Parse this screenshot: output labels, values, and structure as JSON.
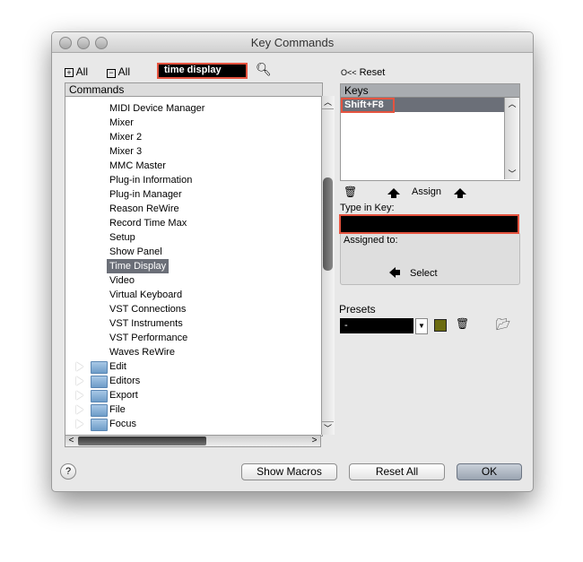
{
  "window": {
    "title": "Key Commands"
  },
  "toolbar": {
    "expand_all": "All",
    "collapse_all": "All",
    "search_value": "time display",
    "reset": "Reset",
    "reset_icon": "O<<"
  },
  "commands": {
    "header": "Commands",
    "items": [
      "MIDI Device Manager",
      "Mixer",
      "Mixer 2",
      "Mixer 3",
      "MMC Master",
      "Plug-in Information",
      "Plug-in Manager",
      "Reason ReWire",
      "Record Time Max",
      "Setup",
      "Show Panel",
      "Time Display",
      "Video",
      "Virtual Keyboard",
      "VST Connections",
      "VST Instruments",
      "VST Performance",
      "Waves ReWire"
    ],
    "selected": "Time Display",
    "folders": [
      "Edit",
      "Editors",
      "Export",
      "File",
      "Focus"
    ]
  },
  "keys": {
    "header": "Keys",
    "items": [
      "Shift+F8"
    ],
    "assign": "Assign",
    "type_in_key_label": "Type in Key:",
    "type_in_key_value": "",
    "assigned_to_label": "Assigned to:",
    "select": "Select"
  },
  "presets": {
    "label": "Presets",
    "value": "-"
  },
  "footer": {
    "help": "?",
    "show_macros": "Show Macros",
    "reset_all": "Reset All",
    "ok": "OK"
  },
  "colors": {
    "highlight": "#e5533f",
    "selection": "#6b6f78"
  }
}
